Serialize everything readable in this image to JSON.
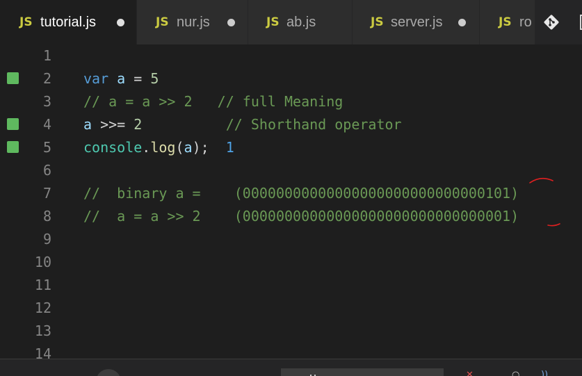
{
  "tabs": [
    {
      "icon": "JS",
      "label": "tutorial.js",
      "active": true,
      "modified": true
    },
    {
      "icon": "JS",
      "label": "nur.js",
      "active": false,
      "modified": true
    },
    {
      "icon": "JS",
      "label": "ab.js",
      "active": false,
      "modified": false
    },
    {
      "icon": "JS",
      "label": "server.js",
      "active": false,
      "modified": true
    },
    {
      "icon": "JS",
      "label": "ro",
      "active": false,
      "modified": false
    }
  ],
  "toolbar": {
    "git_icon": "git-icon",
    "more_icon": "split-editor-icon"
  },
  "editor": {
    "line_numbers": [
      "1",
      "2",
      "3",
      "4",
      "5",
      "6",
      "7",
      "8",
      "9",
      "10",
      "11",
      "12",
      "13",
      "14"
    ],
    "changed_lines": [
      "2",
      "4",
      "5"
    ],
    "line2": {
      "kw": "var",
      "var": "a",
      "op": " = ",
      "num": "5"
    },
    "line3": {
      "comment": "// a = a >> 2   // full Meaning"
    },
    "line4": {
      "var": "a",
      "op": " >>= ",
      "num": "2",
      "comment": "// Shorthand operator"
    },
    "line5": {
      "obj": "console",
      "dot": ".",
      "fn": "log",
      "paren_open": "(",
      "arg": "a",
      "paren_close": ");",
      "result": "1"
    },
    "line7": {
      "comment": "//  binary a =    (00000000000000000000000000000101)"
    },
    "line8": {
      "comment": "//  a = a >> 2    (00000000000000000000000000000001)"
    }
  },
  "colors": {
    "background": "#1e1e1e",
    "tab_inactive": "#2d2d2d",
    "keyword": "#569cd6",
    "comment": "#6a9955",
    "gutter_added": "#5fb95f",
    "annotation": "#e02020"
  }
}
